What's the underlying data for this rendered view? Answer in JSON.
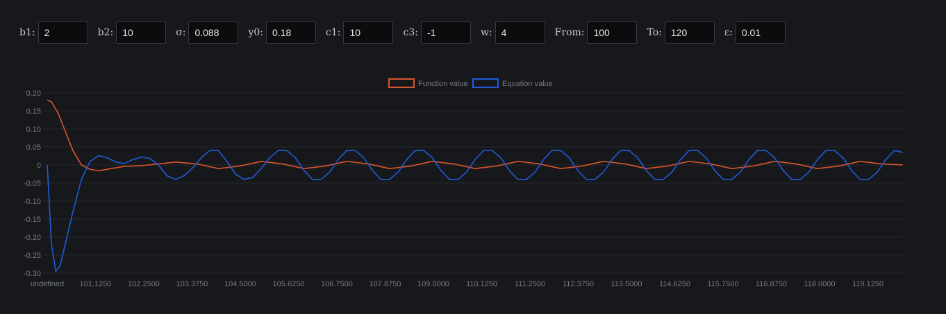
{
  "controls": [
    {
      "label": "b1:",
      "value": "2"
    },
    {
      "label": "b2:",
      "value": "10"
    },
    {
      "label": "σ:",
      "value": "0.088"
    },
    {
      "label": "y0:",
      "value": "0.18"
    },
    {
      "label": "c1:",
      "value": "10"
    },
    {
      "label": "c3:",
      "value": "-1"
    },
    {
      "label": "w:",
      "value": "4"
    },
    {
      "label": "From:",
      "value": "100"
    },
    {
      "label": "To:",
      "value": "120"
    },
    {
      "label": "ε:",
      "value": "0.01"
    }
  ],
  "colors": {
    "background": "#17181c",
    "function_series": "#d9552b",
    "equation_series": "#1f5bd6",
    "grid": "#26272c",
    "tick_text": "#777a80"
  },
  "chart_data": {
    "type": "line",
    "title": "",
    "xlabel": "",
    "ylabel": "",
    "xlim": [
      100,
      120
    ],
    "ylim": [
      -0.3,
      0.2
    ],
    "grid": true,
    "legend_position": "top-center",
    "x_tick_labels": [
      "undefined",
      "101.1250",
      "102.2500",
      "103.3750",
      "104.5000",
      "105.6250",
      "106.7500",
      "107.8750",
      "109.0000",
      "110.1250",
      "111.2500",
      "112.3750",
      "113.5000",
      "114.6250",
      "115.7500",
      "116.8750",
      "118.0000",
      "119.1250"
    ],
    "y_ticks": [
      0.2,
      0.15,
      0.1,
      0.05,
      0,
      -0.05,
      -0.1,
      -0.15,
      -0.2,
      -0.25,
      -0.3
    ],
    "y_tick_labels": [
      "0.20",
      "0.15",
      "0.10",
      "0.05",
      "0",
      "-0.05",
      "-0.10",
      "-0.15",
      "-0.20",
      "-0.25",
      "-0.30"
    ],
    "series": [
      {
        "name": "Function value",
        "color": "#d9552b",
        "x": [
          100,
          100.1,
          100.25,
          100.4,
          100.6,
          100.8,
          101.0,
          101.2,
          101.5,
          101.8,
          102.2,
          102.6,
          103.0,
          103.5,
          104.0,
          104.5,
          105.0,
          105.5,
          106.0,
          106.5,
          107.0,
          107.5,
          108.0,
          108.5,
          109.0,
          109.5,
          110.0,
          110.5,
          111.0,
          111.5,
          112.0,
          112.5,
          113.0,
          113.5,
          114.0,
          114.5,
          115.0,
          115.5,
          116.0,
          116.5,
          117.0,
          117.5,
          118.0,
          118.5,
          119.0,
          119.5,
          120.0
        ],
        "y": [
          0.18,
          0.175,
          0.145,
          0.1,
          0.04,
          0.0,
          -0.012,
          -0.016,
          -0.01,
          -0.004,
          -0.002,
          0.003,
          0.008,
          0.003,
          -0.01,
          -0.003,
          0.01,
          0.003,
          -0.01,
          -0.003,
          0.01,
          0.003,
          -0.01,
          -0.003,
          0.01,
          0.003,
          -0.01,
          -0.003,
          0.01,
          0.003,
          -0.01,
          -0.003,
          0.01,
          0.003,
          -0.01,
          -0.003,
          0.01,
          0.003,
          -0.01,
          -0.003,
          0.01,
          0.003,
          -0.01,
          -0.003,
          0.01,
          0.003,
          0.0
        ]
      },
      {
        "name": "Equation value",
        "color": "#1f5bd6",
        "x": [
          100,
          100.1,
          100.2,
          100.3,
          100.4,
          100.6,
          100.8,
          101.0,
          101.2,
          101.4,
          101.6,
          101.8,
          102.0,
          102.2,
          102.4,
          102.6,
          102.8,
          103.0,
          103.2,
          103.4,
          103.6,
          103.8,
          104.0,
          104.2,
          104.4,
          104.6,
          104.8,
          105.0,
          105.2,
          105.4,
          105.6,
          105.8,
          106.0,
          106.2,
          106.4,
          106.6,
          106.8,
          107.0,
          107.2,
          107.4,
          107.6,
          107.8,
          108.0,
          108.2,
          108.4,
          108.6,
          108.8,
          109.0,
          109.2,
          109.4,
          109.6,
          109.8,
          110.0,
          110.2,
          110.4,
          110.6,
          110.8,
          111.0,
          111.2,
          111.4,
          111.6,
          111.8,
          112.0,
          112.2,
          112.4,
          112.6,
          112.8,
          113.0,
          113.2,
          113.4,
          113.6,
          113.8,
          114.0,
          114.2,
          114.4,
          114.6,
          114.8,
          115.0,
          115.2,
          115.4,
          115.6,
          115.8,
          116.0,
          116.2,
          116.4,
          116.6,
          116.8,
          117.0,
          117.2,
          117.4,
          117.6,
          117.8,
          118.0,
          118.2,
          118.4,
          118.6,
          118.8,
          119.0,
          119.2,
          119.4,
          119.6,
          119.8,
          120.0
        ],
        "y": [
          0.0,
          -0.22,
          -0.295,
          -0.28,
          -0.23,
          -0.13,
          -0.04,
          0.01,
          0.026,
          0.02,
          0.008,
          0.004,
          0.015,
          0.022,
          0.018,
          0.0,
          -0.03,
          -0.04,
          -0.03,
          -0.008,
          0.02,
          0.04,
          0.04,
          0.01,
          -0.025,
          -0.04,
          -0.035,
          -0.01,
          0.02,
          0.04,
          0.04,
          0.02,
          -0.015,
          -0.04,
          -0.04,
          -0.02,
          0.015,
          0.04,
          0.04,
          0.02,
          -0.015,
          -0.04,
          -0.04,
          -0.02,
          0.015,
          0.04,
          0.04,
          0.02,
          -0.015,
          -0.04,
          -0.04,
          -0.02,
          0.015,
          0.04,
          0.04,
          0.02,
          -0.015,
          -0.04,
          -0.04,
          -0.02,
          0.015,
          0.04,
          0.04,
          0.02,
          -0.015,
          -0.04,
          -0.04,
          -0.02,
          0.015,
          0.04,
          0.04,
          0.02,
          -0.015,
          -0.04,
          -0.04,
          -0.02,
          0.015,
          0.04,
          0.04,
          0.02,
          -0.015,
          -0.04,
          -0.04,
          -0.02,
          0.015,
          0.04,
          0.04,
          0.02,
          -0.015,
          -0.04,
          -0.04,
          -0.02,
          0.015,
          0.04,
          0.04,
          0.02,
          -0.015,
          -0.04,
          -0.04,
          -0.02,
          0.015,
          0.04,
          0.035
        ]
      }
    ]
  }
}
